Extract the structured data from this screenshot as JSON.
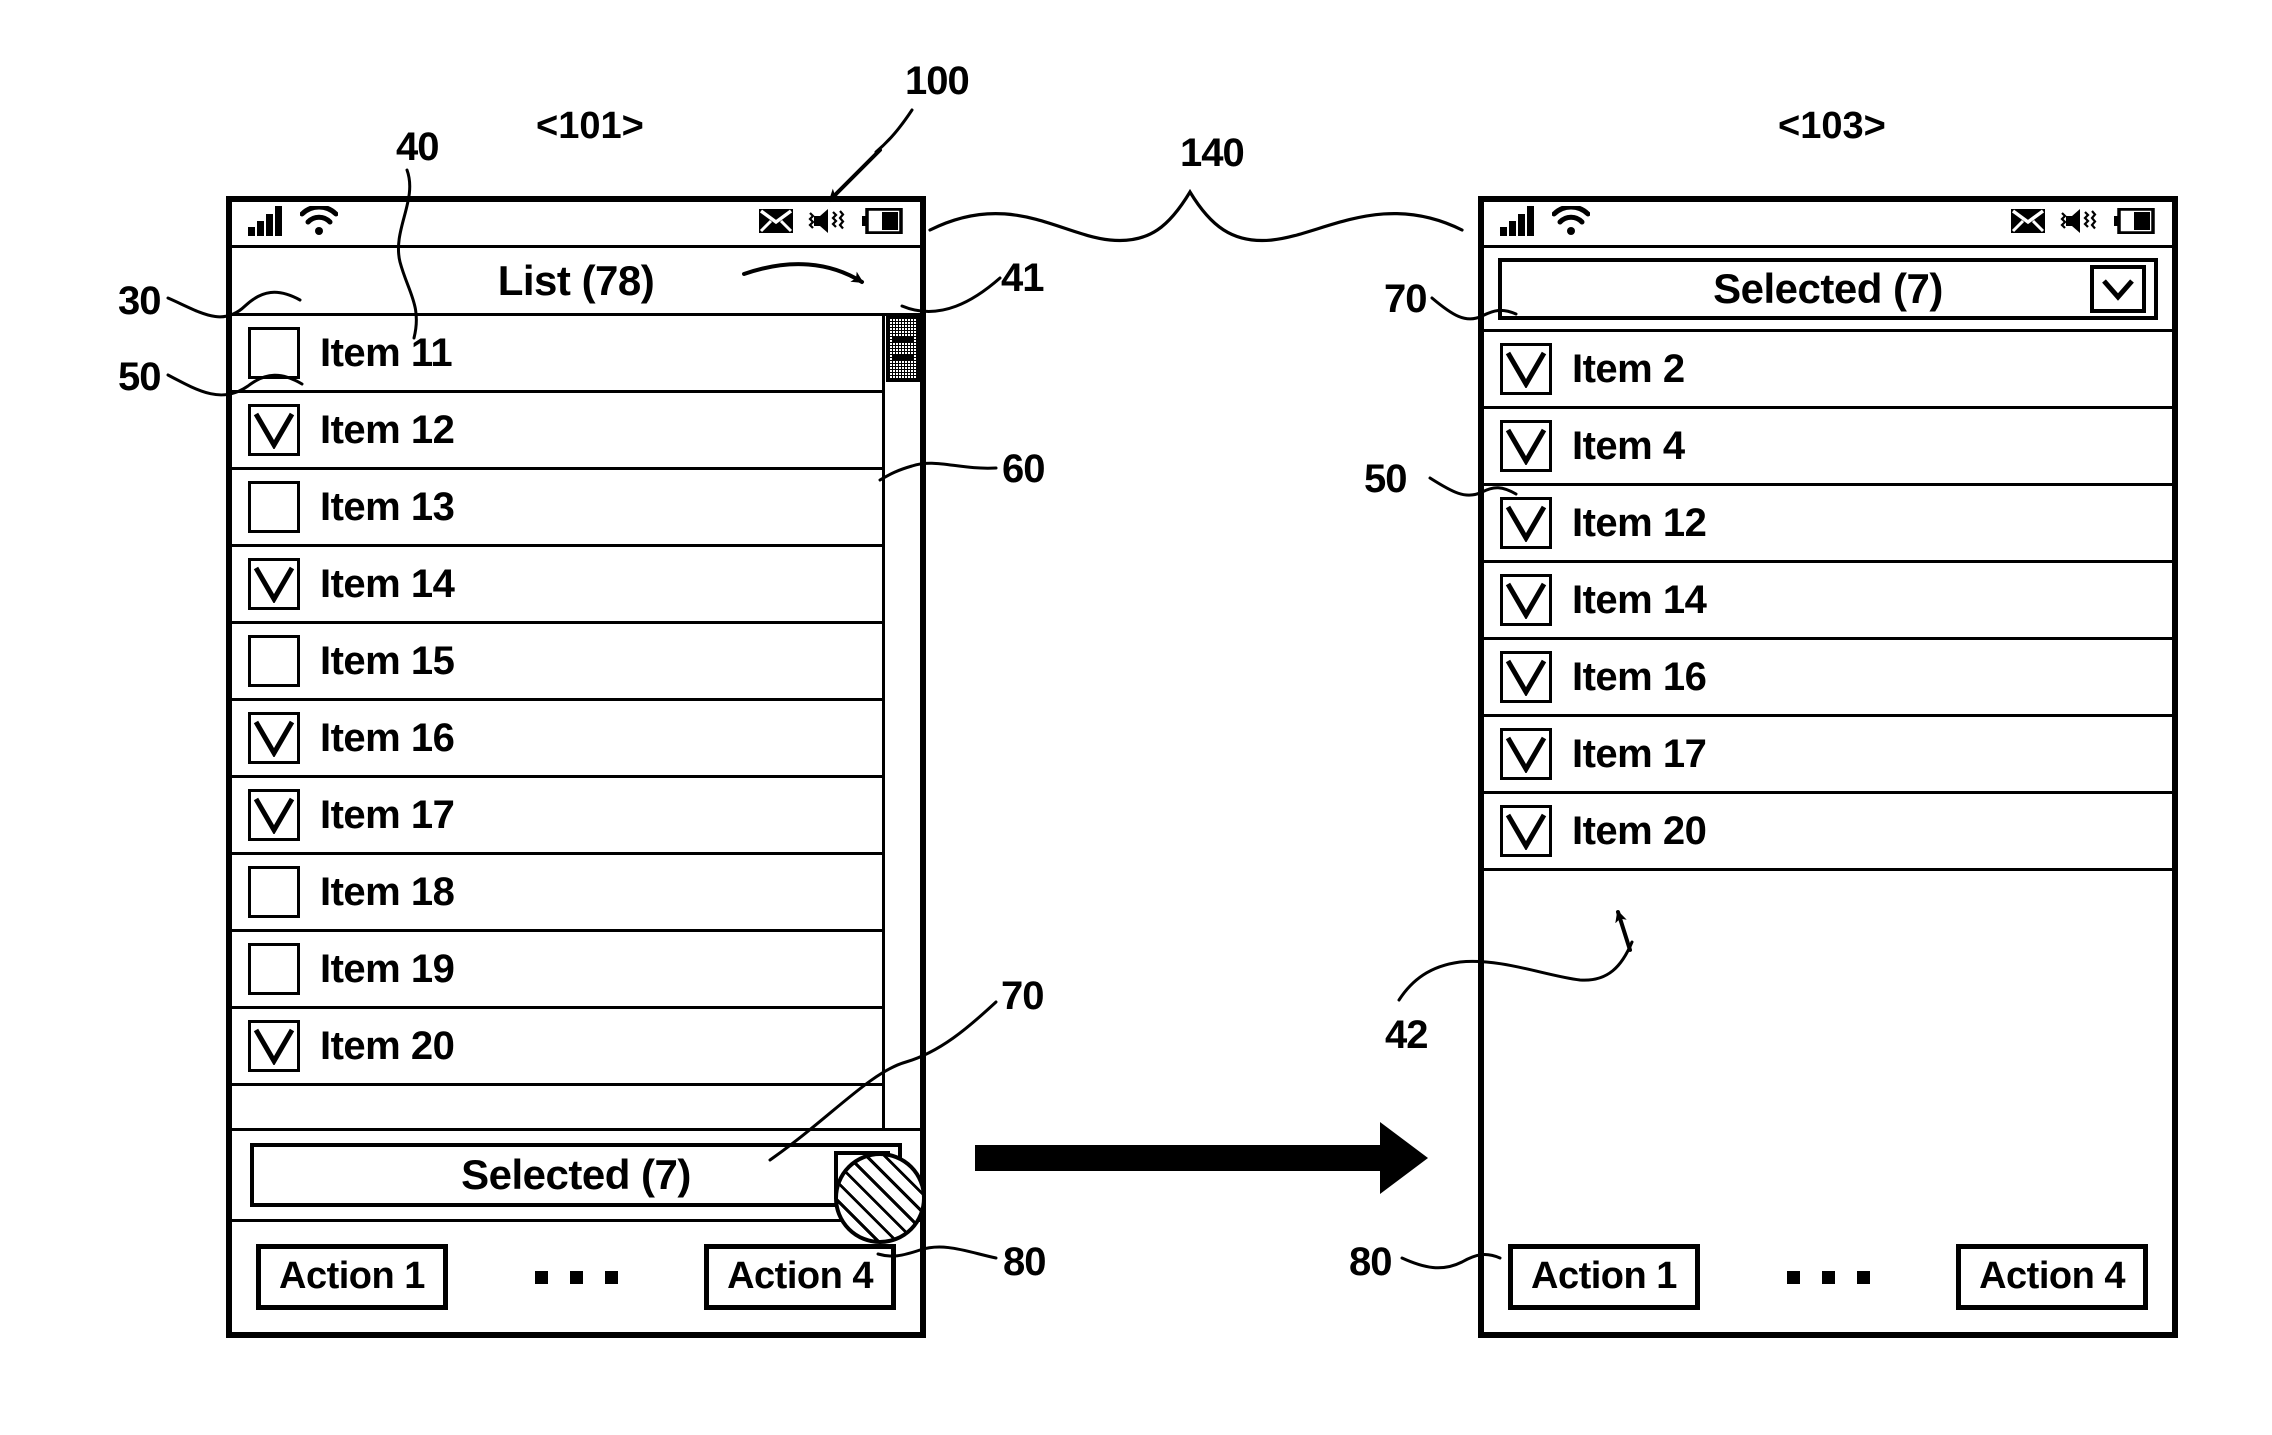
{
  "figure": {
    "left_screen_label": "<101>",
    "right_screen_label": "<103>",
    "transition_ref": "140",
    "device_ref": "100"
  },
  "reference_numerals": {
    "status_bar": "30",
    "title_bar": "40",
    "scroll_thumb": "41",
    "empty_area": "42",
    "checkbox": "50",
    "scroll_track": "60",
    "selected_bar": "70",
    "action_bar": "80"
  },
  "left_phone": {
    "status_icons": {
      "signal": "signal-bars-icon",
      "wifi": "wifi-icon",
      "mail": "mail-icon",
      "sound": "speaker-icon",
      "battery": "battery-icon"
    },
    "title": "List (78)",
    "items": [
      {
        "label": "Item 11",
        "checked": false
      },
      {
        "label": "Item 12",
        "checked": true
      },
      {
        "label": "Item 13",
        "checked": false
      },
      {
        "label": "Item 14",
        "checked": true
      },
      {
        "label": "Item 15",
        "checked": false
      },
      {
        "label": "Item 16",
        "checked": true
      },
      {
        "label": "Item 17",
        "checked": true
      },
      {
        "label": "Item 18",
        "checked": false
      },
      {
        "label": "Item 19",
        "checked": false
      },
      {
        "label": "Item 20",
        "checked": true
      }
    ],
    "selected_bar_text": "Selected (7)",
    "actions": {
      "first": "Action 1",
      "last": "Action 4"
    }
  },
  "right_phone": {
    "status_icons": {
      "signal": "signal-bars-icon",
      "wifi": "wifi-icon",
      "mail": "mail-icon",
      "sound": "speaker-icon",
      "battery": "battery-icon"
    },
    "header_text": "Selected (7)",
    "items": [
      {
        "label": "Item 2",
        "checked": true
      },
      {
        "label": "Item 4",
        "checked": true
      },
      {
        "label": "Item 12",
        "checked": true
      },
      {
        "label": "Item 14",
        "checked": true
      },
      {
        "label": "Item 16",
        "checked": true
      },
      {
        "label": "Item 17",
        "checked": true
      },
      {
        "label": "Item 20",
        "checked": true
      }
    ],
    "actions": {
      "first": "Action 1",
      "last": "Action 4"
    }
  },
  "colors": {
    "ink": "#000000",
    "paper": "#ffffff"
  }
}
